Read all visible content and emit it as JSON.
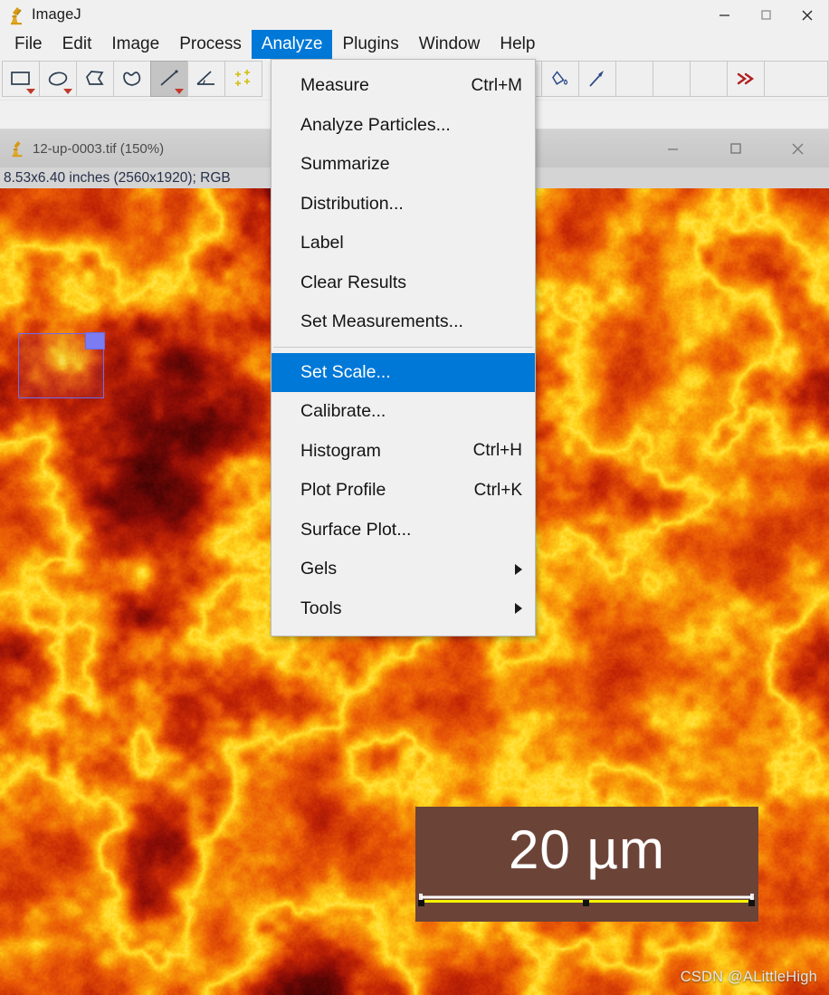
{
  "app": {
    "title": "ImageJ",
    "icon": "microscope-icon",
    "window_controls": {
      "minimize": "—",
      "maximize": "☐",
      "close": "✕"
    }
  },
  "menubar": {
    "items": [
      {
        "label": "File",
        "active": false
      },
      {
        "label": "Edit",
        "active": false
      },
      {
        "label": "Image",
        "active": false
      },
      {
        "label": "Process",
        "active": false
      },
      {
        "label": "Analyze",
        "active": true
      },
      {
        "label": "Plugins",
        "active": false
      },
      {
        "label": "Window",
        "active": false
      },
      {
        "label": "Help",
        "active": false
      }
    ],
    "active_accent": "#0078d7"
  },
  "toolbar": {
    "tools": [
      {
        "name": "rectangle-tool",
        "selected": false,
        "has_dropdown": true
      },
      {
        "name": "oval-tool",
        "selected": false,
        "has_dropdown": true
      },
      {
        "name": "polygon-tool",
        "selected": false,
        "has_dropdown": false
      },
      {
        "name": "freehand-tool",
        "selected": false,
        "has_dropdown": false
      },
      {
        "name": "line-tool",
        "selected": true,
        "has_dropdown": true
      },
      {
        "name": "angle-tool",
        "selected": false,
        "has_dropdown": false
      },
      {
        "name": "point-tool",
        "selected": false,
        "has_dropdown": false
      },
      {
        "name": "brush-tool",
        "selected": false,
        "has_dropdown": false
      },
      {
        "name": "flood-fill-tool",
        "selected": false,
        "has_dropdown": false
      },
      {
        "name": "dropper-tool",
        "selected": false,
        "has_dropdown": false
      },
      {
        "name": "empty-slot-1",
        "selected": false,
        "has_dropdown": false
      },
      {
        "name": "empty-slot-2",
        "selected": false,
        "has_dropdown": false
      },
      {
        "name": "empty-slot-3",
        "selected": false,
        "has_dropdown": false
      },
      {
        "name": "more-tools",
        "selected": false,
        "has_dropdown": false
      }
    ]
  },
  "analyze_menu": {
    "items": [
      {
        "label": "Measure",
        "accel": "Ctrl+M",
        "submenu": false,
        "highlight": false,
        "separator_after": false
      },
      {
        "label": "Analyze Particles...",
        "accel": "",
        "submenu": false,
        "highlight": false,
        "separator_after": false
      },
      {
        "label": "Summarize",
        "accel": "",
        "submenu": false,
        "highlight": false,
        "separator_after": false
      },
      {
        "label": "Distribution...",
        "accel": "",
        "submenu": false,
        "highlight": false,
        "separator_after": false
      },
      {
        "label": "Label",
        "accel": "",
        "submenu": false,
        "highlight": false,
        "separator_after": false
      },
      {
        "label": "Clear Results",
        "accel": "",
        "submenu": false,
        "highlight": false,
        "separator_after": false
      },
      {
        "label": "Set Measurements...",
        "accel": "",
        "submenu": false,
        "highlight": false,
        "separator_after": true
      },
      {
        "label": "Set Scale...",
        "accel": "",
        "submenu": false,
        "highlight": true,
        "separator_after": false
      },
      {
        "label": "Calibrate...",
        "accel": "",
        "submenu": false,
        "highlight": false,
        "separator_after": false
      },
      {
        "label": "Histogram",
        "accel": "Ctrl+H",
        "submenu": false,
        "highlight": false,
        "separator_after": false
      },
      {
        "label": "Plot Profile",
        "accel": "Ctrl+K",
        "submenu": false,
        "highlight": false,
        "separator_after": false
      },
      {
        "label": "Surface Plot...",
        "accel": "",
        "submenu": false,
        "highlight": false,
        "separator_after": false
      },
      {
        "label": "Gels",
        "accel": "",
        "submenu": true,
        "highlight": false,
        "separator_after": false
      },
      {
        "label": "Tools",
        "accel": "",
        "submenu": true,
        "highlight": false,
        "separator_after": false
      }
    ],
    "highlight_color": "#0078d7"
  },
  "image_window": {
    "title": "12-up-0003.tif (150%)",
    "icon": "microscope-icon",
    "info": "8.53x6.40 inches (2560x1920); RGB",
    "zoom": "150%",
    "filename": "12-up-0003.tif",
    "dimensions_px": "2560x1920",
    "dimensions_in": "8.53x6.40 inches",
    "color_mode": "RGB",
    "window_controls": {
      "minimize": "—",
      "maximize": "☐",
      "close": "✕"
    }
  },
  "overlay": {
    "scalebar_label": "20 µm",
    "scalebar_bg": "#6b4337",
    "scalebar_fg": "#ffffff",
    "scalebar_line_color": "#f4f400"
  },
  "roi": {
    "name": "rectangular-selection",
    "stroke": "#6c6cf0",
    "handle_color": "#7b7bf2"
  },
  "watermark": {
    "text": "CSDN @ALittleHigh"
  }
}
